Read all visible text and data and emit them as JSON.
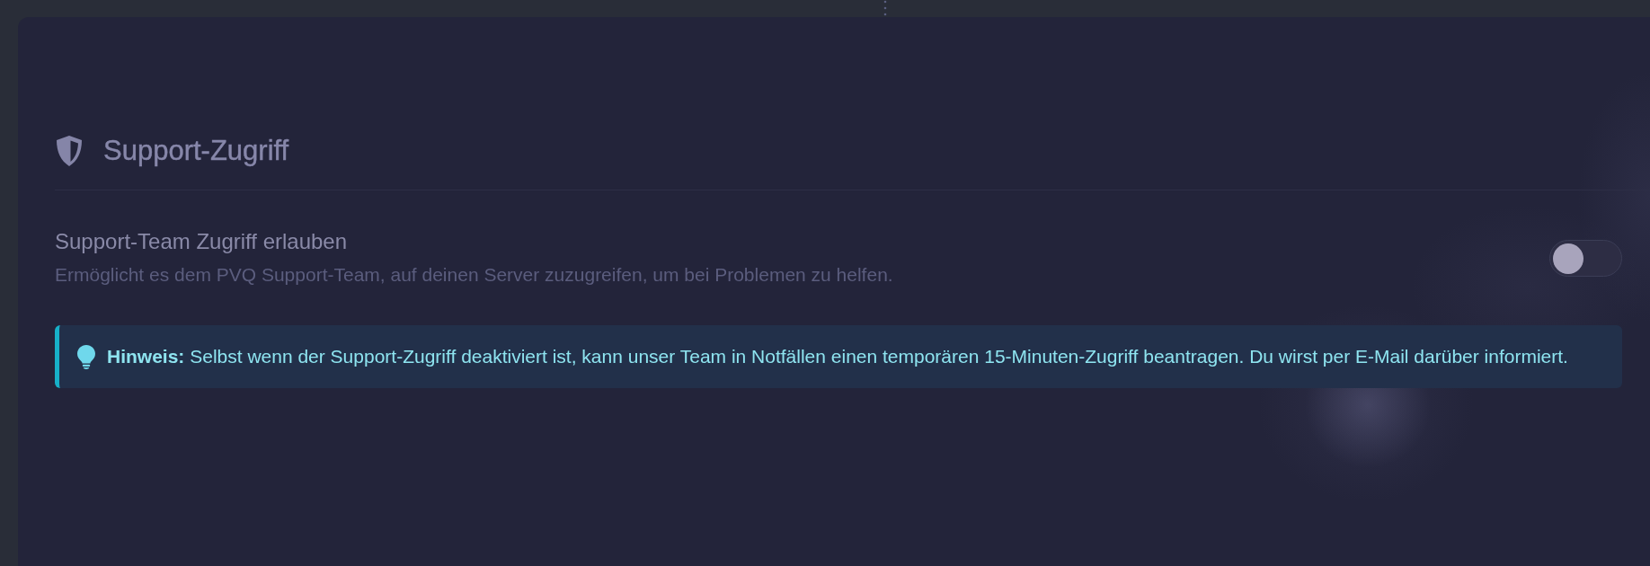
{
  "section": {
    "title": "Support-Zugriff"
  },
  "setting": {
    "label": "Support-Team Zugriff erlauben",
    "description": "Ermöglicht es dem PVQ Support-Team, auf deinen Server zuzugreifen, um bei Problemen zu helfen.",
    "on": false
  },
  "notice": {
    "text": "**Hinweis:** Selbst wenn der Support-Zugriff deaktiviert ist, kann unser Team in Notfällen einen temporären 15-Minuten-Zugriff beantragen. Du wirst per E-Mail darüber informiert."
  }
}
